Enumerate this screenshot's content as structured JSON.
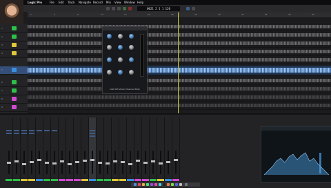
{
  "menu_bar": {
    "app_name": "Logic Pro",
    "items": [
      "File",
      "Edit",
      "Track",
      "Navigate",
      "Record",
      "Mix",
      "View",
      "Window",
      "Help"
    ]
  },
  "control_bar": {
    "lcd": "0021 2 1 1   120"
  },
  "ruler": {
    "bars": [
      "1",
      "5",
      "9",
      "13",
      "17",
      "21",
      "25",
      "29",
      "33",
      "37",
      "41",
      "45",
      "49"
    ]
  },
  "tracks": [
    {
      "num": "1",
      "name": "",
      "color": "#2fbf4a"
    },
    {
      "num": "2",
      "name": "",
      "color": "#2fbf4a"
    },
    {
      "num": "3",
      "name": "",
      "color": "#e0c63a"
    },
    {
      "num": "4",
      "name": "",
      "color": "#e0c63a"
    },
    {
      "num": "5",
      "name": "",
      "color": "#3a8fe0"
    },
    {
      "num": "6",
      "name": "",
      "color": "#2fbf4a"
    },
    {
      "num": "7",
      "name": "",
      "color": "#2fbf4a"
    },
    {
      "num": "8",
      "name": "",
      "color": "#d04ad0"
    },
    {
      "num": "9",
      "name": "",
      "color": "#d04ad0"
    },
    {
      "num": "10",
      "name": "",
      "color": "#d04ad0"
    }
  ],
  "plugin_window": {
    "title": "UAD API Vision Channel Strip"
  },
  "colors": {
    "accent": "#3a8fe0",
    "playhead": "#d9d24a",
    "selected_track": "#3a8fe0"
  }
}
